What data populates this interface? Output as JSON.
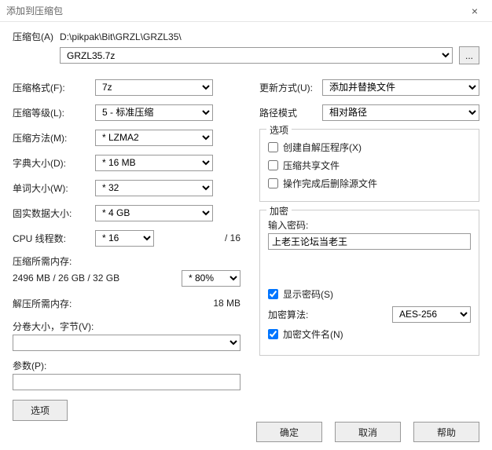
{
  "window": {
    "title": "添加到压缩包",
    "close_glyph": "×"
  },
  "archive": {
    "label": "压缩包(A)",
    "path": "D:\\pikpak\\Bit\\GRZL\\GRZL35\\",
    "filename": "GRZL35.7z",
    "browse_label": "..."
  },
  "left": {
    "format": {
      "label": "压缩格式(F):",
      "value": "7z"
    },
    "level": {
      "label": "压缩等级(L):",
      "value": "5 - 标准压缩"
    },
    "method": {
      "label": "压缩方法(M):",
      "value": "* LZMA2"
    },
    "dict": {
      "label": "字典大小(D):",
      "value": "* 16 MB"
    },
    "word": {
      "label": "单词大小(W):",
      "value": "* 32"
    },
    "solid": {
      "label": "固实数据大小:",
      "value": "* 4 GB"
    },
    "threads": {
      "label": "CPU 线程数:",
      "value": "* 16",
      "of": "/ 16"
    },
    "mem_comp": {
      "label": "压缩所需内存:",
      "value": "2496 MB / 26 GB / 32 GB",
      "ratio": "* 80%"
    },
    "mem_decomp": {
      "label": "解压所需内存:",
      "value": "18 MB"
    },
    "split": {
      "label": "分卷大小，字节(V):"
    },
    "params": {
      "label": "参数(P):",
      "value": ""
    },
    "options_btn": "选项"
  },
  "right": {
    "update": {
      "label": "更新方式(U):",
      "value": "添加并替换文件"
    },
    "pathmode": {
      "label": "路径模式",
      "value": "相对路径"
    },
    "options": {
      "legend": "选项",
      "sfx": "创建自解压程序(X)",
      "shared": "压缩共享文件",
      "delete_after": "操作完成后删除源文件"
    },
    "encrypt": {
      "legend": "加密",
      "pw_label": "输入密码:",
      "pw_value": "上老王论坛当老王",
      "show_pw": "显示密码(S)",
      "algo_label": "加密算法:",
      "algo_value": "AES-256",
      "encrypt_names": "加密文件名(N)"
    }
  },
  "buttons": {
    "ok": "确定",
    "cancel": "取消",
    "help": "帮助"
  }
}
